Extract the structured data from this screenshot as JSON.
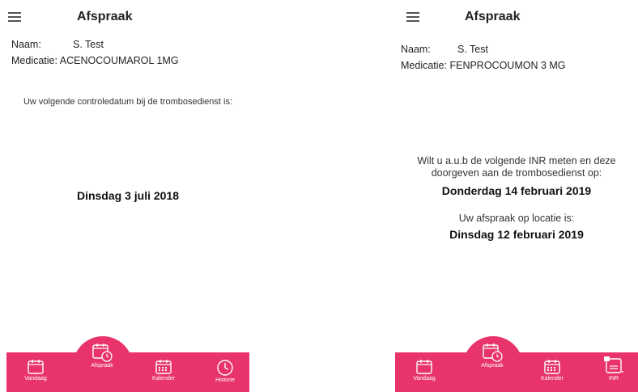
{
  "screens": [
    {
      "app_title": "Afspraak",
      "naam_label": "Naam:",
      "naam_value": "S. Test",
      "medicatie_label": "Medicatie:",
      "medicatie_value": "ACENOCOUMAROL 1MG",
      "message": "Uw volgende controledatum bij de trombosedienst is:",
      "date": "Dinsdag 3 juli 2018",
      "nav": [
        "Vandaag",
        "Afspraak",
        "Kalender",
        "Historie"
      ]
    },
    {
      "app_title": "Afspraak",
      "naam_label": "Naam:",
      "naam_value": "S. Test",
      "medicatie_label": "Medicatie:",
      "medicatie_value": "FENPROCOUMON 3 MG",
      "message_line1": "Wilt u a.u.b de volgende INR meten en deze",
      "message_line2": "doorgeven aan de trombosedienst op:",
      "date_inr": "Donderdag 14 februari 2019",
      "location_message": "Uw afspraak op locatie is:",
      "date_location": "Dinsdag 12 februari 2019",
      "nav": [
        "Vandaag",
        "Afspraak",
        "Kalender",
        "INR"
      ]
    }
  ],
  "colors": {
    "nav_bg": "#e8336b",
    "nav_fg": "#ffffff"
  },
  "icons": [
    "menu-icon",
    "calendar-icon",
    "calendar-clock-icon",
    "calendar-grid-icon",
    "clock-icon",
    "inr-device-icon"
  ]
}
